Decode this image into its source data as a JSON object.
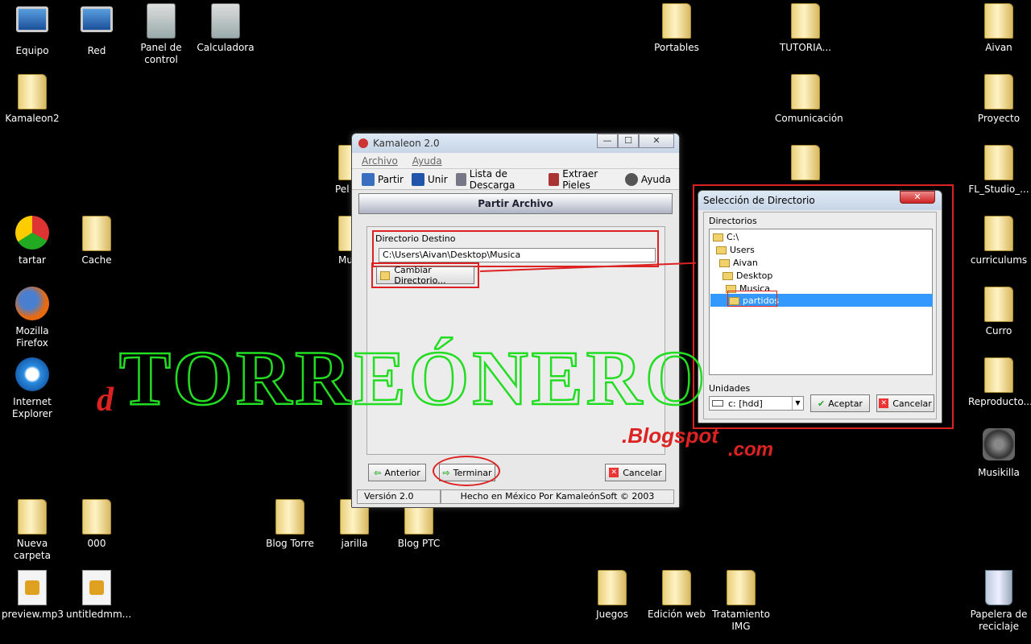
{
  "desktop": {
    "icons": [
      {
        "label": "Equipo",
        "kind": "computer"
      },
      {
        "label": "Red",
        "kind": "network"
      },
      {
        "label": "Panel de control",
        "kind": "control-panel"
      },
      {
        "label": "Calculadora",
        "kind": "calculator"
      },
      {
        "label": "Kamaleon2",
        "kind": "folder"
      },
      {
        "label": "tartar",
        "kind": "chrome"
      },
      {
        "label": "Cache",
        "kind": "folder"
      },
      {
        "label": "Mozilla Firefox",
        "kind": "firefox"
      },
      {
        "label": "Internet Explorer",
        "kind": "ie"
      },
      {
        "label": "Nueva carpeta",
        "kind": "folder"
      },
      {
        "label": "000",
        "kind": "folder"
      },
      {
        "label": "preview.mp3",
        "kind": "file"
      },
      {
        "label": "untitledmm...",
        "kind": "file"
      },
      {
        "label": "Blog Torre",
        "kind": "folder"
      },
      {
        "label": "jarilla",
        "kind": "folder"
      },
      {
        "label": "Blog PTC",
        "kind": "folder"
      },
      {
        "label": "Portables",
        "kind": "folder"
      },
      {
        "label": "TUTORIA...",
        "kind": "folder"
      },
      {
        "label": "Comunicación",
        "kind": "folder"
      },
      {
        "label": "Aivan",
        "kind": "folder"
      },
      {
        "label": "Proyecto",
        "kind": "folder"
      },
      {
        "label": "FL_Studio_...",
        "kind": "folder"
      },
      {
        "label": "curriculums",
        "kind": "folder"
      },
      {
        "label": "Curro",
        "kind": "folder"
      },
      {
        "label": "Reproducto...",
        "kind": "folder"
      },
      {
        "label": "Musikilla",
        "kind": "speaker"
      },
      {
        "label": "Juegos",
        "kind": "folder"
      },
      {
        "label": "Edición web",
        "kind": "folder"
      },
      {
        "label": "Tratamiento IMG",
        "kind": "folder"
      },
      {
        "label": "Papelera de reciclaje",
        "kind": "recycle"
      },
      {
        "label": "Pel",
        "kind": "folder"
      },
      {
        "label": "Mu",
        "kind": "folder"
      }
    ]
  },
  "app": {
    "title": "Kamaleon 2.0",
    "window_buttons": {
      "minimize": "—",
      "maximize": "☐",
      "close": "✕"
    },
    "menu": [
      "Archivo",
      "Ayuda"
    ],
    "toolbar": [
      "Partir",
      "Unir",
      "Lista de Descarga",
      "Extraer Pieles",
      "Ayuda"
    ],
    "header": "Partir Archivo",
    "dest_label": "Directorio Destino",
    "dest_value": "C:\\Users\\Aivan\\Desktop\\Musica",
    "change_dir_label": "Cambiar Directorio...",
    "back_label": "Anterior",
    "finish_label": "Terminar",
    "cancel_label": "Cancelar",
    "status_version": "Versión 2.0",
    "status_credit": "Hecho en México Por KamaleónSoft © 2003"
  },
  "dialog": {
    "title": "Selección de Directorio",
    "close": "✕",
    "dirs_label": "Directorios",
    "tree": [
      "C:\\",
      "Users",
      "Aivan",
      "Desktop",
      "Musica",
      "partidos"
    ],
    "selected": "partidos",
    "drives_label": "Unidades",
    "drive_value": "c: [hdd]",
    "ok_label": "Aceptar",
    "cancel_label": "Cancelar"
  },
  "watermark": {
    "prefix": "d",
    "main": "TORREÓNERO",
    "suffix1": ".Blogspot",
    "suffix2": ".com"
  },
  "colors": {
    "highlight_red": "#dd2222",
    "watermark_green": "#22dd22",
    "selection_blue": "#3399ff"
  }
}
